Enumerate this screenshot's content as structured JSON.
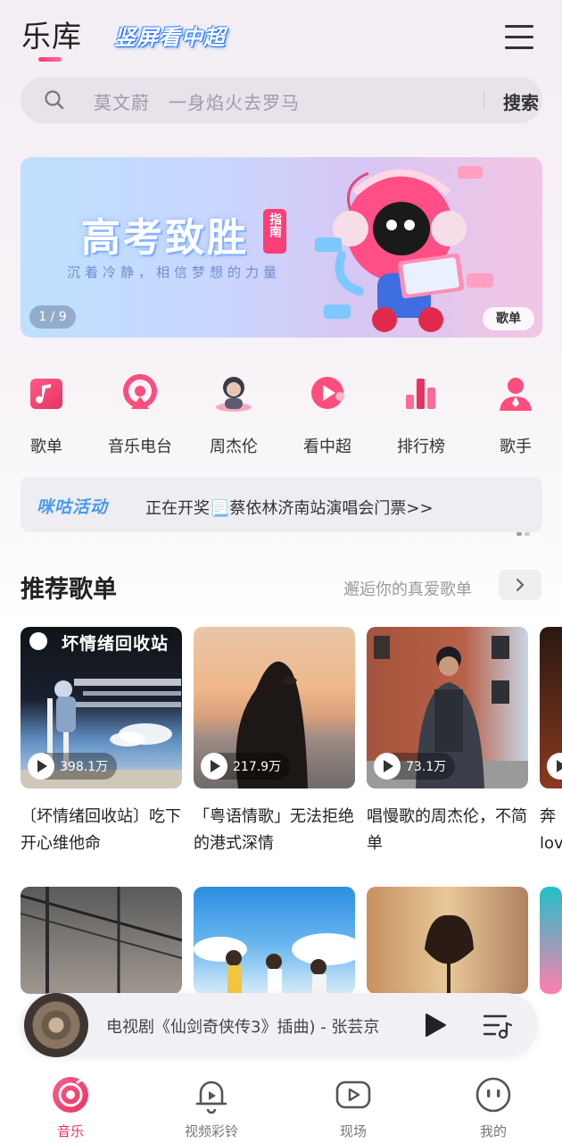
{
  "header": {
    "title": "乐库",
    "promo": "竖屏看中超"
  },
  "search": {
    "placeholder": "莫文蔚　一身焰火去罗马",
    "button": "搜索"
  },
  "banner": {
    "title": "高考致胜",
    "badge": "指南",
    "subtitle": "沉着冷静，相信梦想的力量",
    "counter": "1 / 9",
    "tag": "歌单"
  },
  "quick_entries": [
    {
      "label": "歌单",
      "icon": "playlist-icon"
    },
    {
      "label": "音乐电台",
      "icon": "radio-icon"
    },
    {
      "label": "周杰伦",
      "icon": "artist-avatar-icon"
    },
    {
      "label": "看中超",
      "icon": "video-play-icon"
    },
    {
      "label": "排行榜",
      "icon": "chart-bars-icon"
    },
    {
      "label": "歌手",
      "icon": "singer-icon"
    }
  ],
  "notice": {
    "brand": "咪咕活动",
    "text": "正在开奖📃蔡依林济南站演唱会门票>>"
  },
  "section": {
    "title": "推荐歌单",
    "subtitle": "邂逅你的真爱歌单"
  },
  "playlists": [
    {
      "cover_text": "坏情绪回收站",
      "plays": "398.1万",
      "title": "〔坏情绪回收站〕吃下开心维他命"
    },
    {
      "cover_text": "",
      "plays": "217.9万",
      "title": "「粤语情歌」无法拒绝的港式深情"
    },
    {
      "cover_text": "",
      "plays": "73.1万",
      "title": "唱慢歌的周杰伦，不简单"
    },
    {
      "cover_text": "",
      "plays": "",
      "title": "奔\nlov"
    }
  ],
  "player": {
    "track": "电视剧《仙剑奇侠传3》插曲) - 张芸京"
  },
  "tabs": [
    {
      "label": "音乐",
      "icon": "music-disc-icon",
      "active": true
    },
    {
      "label": "视频彩铃",
      "icon": "video-ringtone-icon",
      "active": false
    },
    {
      "label": "现场",
      "icon": "live-play-icon",
      "active": false
    },
    {
      "label": "我的",
      "icon": "profile-face-icon",
      "active": false
    }
  ],
  "colors": {
    "accent": "#e8325f",
    "brand_blue": "#4a9af0"
  }
}
